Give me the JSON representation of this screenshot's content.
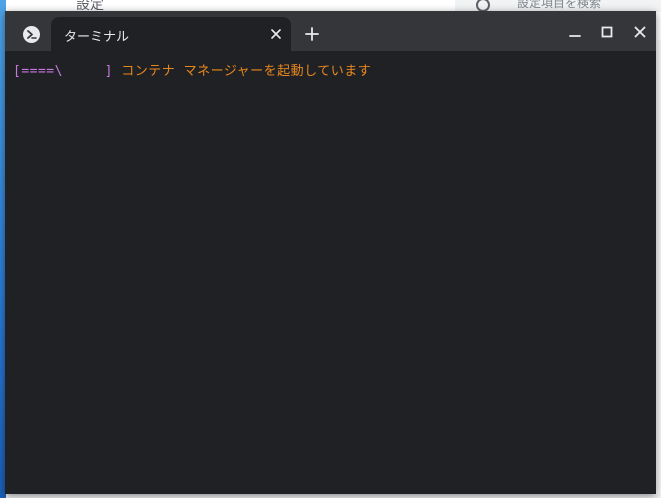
{
  "background": {
    "settings_title": "設定",
    "search_placeholder": "設定項目を検索"
  },
  "terminal": {
    "tab_title": "ターミナル",
    "progress_indicator": "[====\\     ]",
    "status_message": " コンテナ マネージャーを起動しています"
  },
  "icons": {
    "app": "terminal-app-icon",
    "tab_close": "close-icon",
    "new_tab": "plus-icon",
    "minimize": "minimize-icon",
    "maximize": "maximize-icon",
    "close": "close-icon"
  },
  "colors": {
    "titlebar": "#35363a",
    "terminal_bg": "#202124",
    "progress": "#c678dd",
    "message": "#e8871e",
    "text": "#e8eaed"
  }
}
